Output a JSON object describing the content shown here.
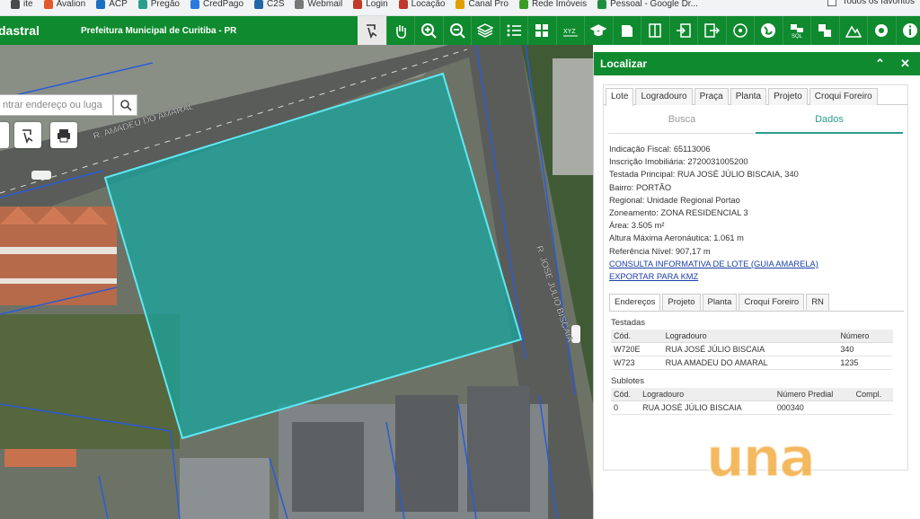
{
  "bookmarks": [
    {
      "label": "ite",
      "color": "#4a4a4a"
    },
    {
      "label": "Avalion",
      "color": "#e05a2a"
    },
    {
      "label": "ACP",
      "color": "#1a6ec2"
    },
    {
      "label": "Pregão",
      "color": "#2a9d8f"
    },
    {
      "label": "CredPago",
      "color": "#2a7ae0"
    },
    {
      "label": "C2S",
      "color": "#2266aa"
    },
    {
      "label": "Webmail",
      "color": "#777"
    },
    {
      "label": "Login",
      "color": "#c0392b"
    },
    {
      "label": "Locação",
      "color": "#c0392b"
    },
    {
      "label": "Canal Pro",
      "color": "#e0a000"
    },
    {
      "label": "Rede Imóveis",
      "color": "#3a9d23"
    },
    {
      "label": "Pessoal - Google Dr...",
      "color": "#1e8e3e"
    }
  ],
  "bookmarks_right": "Todos os favoritos",
  "header": {
    "brand": "dastral",
    "subtitle": "Prefeitura Municipal de Curitiba - PR"
  },
  "toolbar_icons": [
    "identify-icon",
    "pan-icon",
    "zoom-in-icon",
    "zoom-out-icon",
    "layers-icon",
    "legend-icon",
    "grid-icon",
    "xyz-icon",
    "education-icon",
    "bookmark-map-icon",
    "split-icon",
    "import-icon",
    "export-icon",
    "target-icon",
    "globe-icon",
    "sql-icon",
    "print-map-icon",
    "terrain-icon",
    "settings-icon",
    "info-icon"
  ],
  "toolbar_xyz": "XYZ",
  "toolbar_sql": "SQL",
  "map": {
    "search_placeholder": "ntrar endereço ou luga",
    "street1": "R. AMADEU DO AMARAL",
    "street2": "R. JOSÉ JÚLIO BISCAIA"
  },
  "panel": {
    "title": "Localizar",
    "tabs": [
      "Lote",
      "Logradouro",
      "Praça",
      "Planta",
      "Projeto",
      "Croqui Foreiro"
    ],
    "active_tab": "Lote",
    "subtabs": [
      "Busca",
      "Dados"
    ],
    "info": [
      "Indicação Fiscal: 65113006",
      "Inscrição Imobiliária: 2720031005200",
      "Testada Principal: RUA JOSÉ JÚLIO BISCAIA, 340",
      "Bairro: PORTÃO",
      "Regional: Unidade Regional Portao",
      "Zoneamento: ZONA RESIDENCIAL 3",
      "Área: 3.505 m²",
      "Altura Máxima Aeronáutica: 1.061 m",
      "Referência Nível: 907,17 m"
    ],
    "links": [
      "CONSULTA INFORMATIVA DE LOTE (GUIA AMARELA)",
      "EXPORTAR PARA KMZ"
    ],
    "lower_tabs": [
      "Endereços",
      "Projeto",
      "Planta",
      "Croqui Foreiro",
      "RN"
    ],
    "testadas_title": "Testadas",
    "testadas_headers": [
      "Cód.",
      "Logradouro",
      "Número"
    ],
    "testadas_rows": [
      [
        "W720E",
        "RUA JOSÉ JÚLIO BISCAIA",
        "340"
      ],
      [
        "W723",
        "RUA AMADEU DO AMARAL",
        "1235"
      ]
    ],
    "sublotes_title": "Sublotes",
    "sublotes_headers": [
      "Cód.",
      "Logradouro",
      "Número Predial",
      "Compl."
    ],
    "sublotes_rows": [
      [
        "0",
        "RUA JOSÉ JÚLIO BISCAIA",
        "000340",
        ""
      ]
    ]
  },
  "watermark": "una"
}
